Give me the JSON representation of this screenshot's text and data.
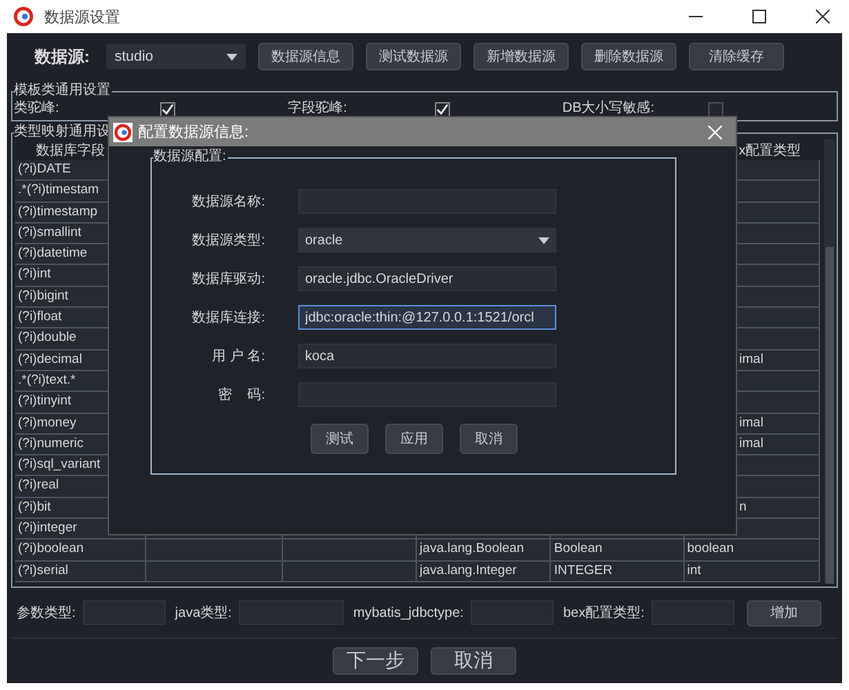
{
  "window": {
    "title": "数据源设置"
  },
  "toolbar": {
    "label": "数据源:",
    "datasource": "studio",
    "buttons": [
      "数据源信息",
      "测试数据源",
      "新增数据源",
      "删除数据源",
      "清除缓存"
    ]
  },
  "template_settings": {
    "legend": "模板类通用设置",
    "options": [
      {
        "label": "类驼峰:",
        "checked": true
      },
      {
        "label": "字段驼峰:",
        "checked": true
      },
      {
        "label": "DB大小写敏感:",
        "checked": false
      }
    ]
  },
  "type_mapping": {
    "legend": "类型映射通用设",
    "columns": [
      "数据库字段",
      "x配置类型"
    ],
    "rows": [
      {
        "cells": [
          "(?i)DATE",
          "",
          "",
          "",
          "",
          ""
        ]
      },
      {
        "cells": [
          ".*(?i)timestam",
          "",
          "",
          "",
          "",
          ""
        ]
      },
      {
        "cells": [
          "(?i)timestamp",
          "",
          "",
          "",
          "",
          ""
        ]
      },
      {
        "cells": [
          "(?i)smallint",
          "",
          "",
          "",
          "",
          ""
        ]
      },
      {
        "cells": [
          "(?i)datetime",
          "",
          "",
          "",
          "",
          ""
        ]
      },
      {
        "cells": [
          "(?i)int",
          "",
          "",
          "",
          "",
          ""
        ]
      },
      {
        "cells": [
          "(?i)bigint",
          "",
          "",
          "",
          "",
          ""
        ]
      },
      {
        "cells": [
          "(?i)float",
          "",
          "",
          "",
          "",
          ""
        ]
      },
      {
        "cells": [
          "(?i)double",
          "",
          "",
          "",
          "",
          ""
        ]
      },
      {
        "cells": [
          "(?i)decimal",
          "",
          "",
          "",
          "",
          "imal"
        ]
      },
      {
        "cells": [
          ".*(?i)text.*",
          "",
          "",
          "",
          "",
          ""
        ]
      },
      {
        "cells": [
          "(?i)tinyint",
          "",
          "",
          "",
          "",
          ""
        ]
      },
      {
        "cells": [
          "(?i)money",
          "",
          "",
          "",
          "",
          "imal"
        ]
      },
      {
        "cells": [
          "(?i)numeric",
          "",
          "",
          "",
          "",
          "imal"
        ]
      },
      {
        "cells": [
          "(?i)sql_variant",
          "",
          "",
          "",
          "",
          ""
        ]
      },
      {
        "cells": [
          "(?i)real",
          "",
          "",
          "",
          "",
          ""
        ]
      },
      {
        "cells": [
          "(?i)bit",
          "",
          "",
          "",
          "",
          "n"
        ]
      },
      {
        "cells": [
          "(?i)integer",
          "",
          "",
          "",
          "",
          ""
        ]
      },
      {
        "cells": [
          "(?i)boolean",
          "",
          "",
          "java.lang.Boolean",
          "Boolean",
          "boolean"
        ]
      },
      {
        "cells": [
          "(?i)serial",
          "",
          "",
          "java.lang.Integer",
          "INTEGER",
          "int"
        ]
      }
    ]
  },
  "add_row": {
    "fields": [
      {
        "label": "参数类型:"
      },
      {
        "label": "java类型:"
      },
      {
        "label": "mybatis_jdbctype:"
      },
      {
        "label": "bex配置类型:"
      }
    ],
    "button": "增加"
  },
  "footer_buttons": [
    "下一步",
    "取消"
  ],
  "dialog": {
    "title": "配置数据源信息:",
    "legend": "数据源配置:",
    "fields": [
      {
        "label": "数据源名称:",
        "kind": "text",
        "focused": false
      },
      {
        "label": "数据源类型:",
        "kind": "select",
        "value": "oracle",
        "focused": false
      },
      {
        "label": "数据库驱动:",
        "kind": "text",
        "value": "oracle.jdbc.OracleDriver",
        "focused": false
      },
      {
        "label": "数据库连接:",
        "kind": "text",
        "value": "jdbc:oracle:thin:@127.0.0.1:1521/orcl",
        "focused": true
      },
      {
        "label": "用 户 名:",
        "kind": "text",
        "value": "koca",
        "focused": false
      },
      {
        "label": "密    码:",
        "kind": "password",
        "focused": false
      }
    ],
    "buttons": [
      "测试",
      "应用",
      "取消"
    ]
  }
}
